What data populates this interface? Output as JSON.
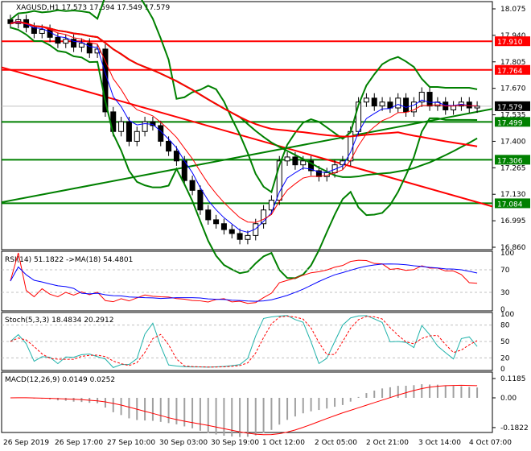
{
  "header": {
    "symbol": "XAGUSD,H1",
    "open": "17.573",
    "high": "17.594",
    "low": "17.549",
    "close": "17.579"
  },
  "chart_data": {
    "type": "candlestick",
    "title": "XAGUSD,H1 17.573 17.594 17.549 17.579",
    "price_ticks": [
      "18.075",
      "17.940",
      "17.805",
      "17.670",
      "17.535",
      "17.400",
      "17.265",
      "17.130",
      "16.995",
      "16.860"
    ],
    "ylim": [
      16.86,
      18.075
    ],
    "closes": [
      18.0,
      18.02,
      17.98,
      17.95,
      17.97,
      17.93,
      17.9,
      17.92,
      17.88,
      17.9,
      17.85,
      17.87,
      17.55,
      17.45,
      17.5,
      17.4,
      17.45,
      17.5,
      17.48,
      17.4,
      17.35,
      17.3,
      17.2,
      17.15,
      17.05,
      17.0,
      16.98,
      16.95,
      16.93,
      16.9,
      16.92,
      16.98,
      17.05,
      17.1,
      17.3,
      17.32,
      17.28,
      17.3,
      17.25,
      17.22,
      17.24,
      17.28,
      17.3,
      17.45,
      17.6,
      17.62,
      17.58,
      17.6,
      17.57,
      17.62,
      17.55,
      17.6,
      17.65,
      17.58,
      17.6,
      17.56,
      17.58,
      17.6,
      17.57,
      17.579
    ],
    "current_price": {
      "label": "17.579",
      "value": 17.579
    },
    "levels": [
      {
        "label": "17.910",
        "value": 17.91,
        "color": "#ff0000"
      },
      {
        "label": "17.764",
        "value": 17.764,
        "color": "#ff0000"
      },
      {
        "label": "17.499",
        "value": 17.499,
        "color": "#008000"
      },
      {
        "label": "17.306",
        "value": 17.306,
        "color": "#008000"
      },
      {
        "label": "17.084",
        "value": 17.084,
        "color": "#008000"
      }
    ],
    "trendlines": [
      {
        "color": "#ff0000",
        "from": [
          0,
          17.77
        ],
        "to": [
          59,
          17.09
        ]
      },
      {
        "color": "#008000",
        "from": [
          37,
          17.38
        ],
        "to": [
          59,
          17.55
        ]
      }
    ],
    "x_labels": [
      "26 Sep 2019",
      "26 Sep 17:00",
      "27 Sep 10:00",
      "30 Sep 03:00",
      "30 Sep 19:00",
      "1 Oct 12:00",
      "2 Oct 05:00",
      "2 Oct 21:00",
      "3 Oct 14:00",
      "4 Oct 07:00"
    ],
    "rsi": {
      "title": "RSI(14) 51.1822  ->MA(18) 54.4801",
      "ticks": [
        "100",
        "70",
        "30",
        "0"
      ]
    },
    "stoch": {
      "title": "Stoch(5,3,3) 18.4834 20.2912",
      "ticks": [
        "100",
        "80",
        "50",
        "20",
        "0"
      ]
    },
    "macd": {
      "title": "MACD(12,26,9) 0.0149 0.0252",
      "ticks": [
        "0.1185",
        "0.00",
        "-0.1822"
      ]
    }
  }
}
